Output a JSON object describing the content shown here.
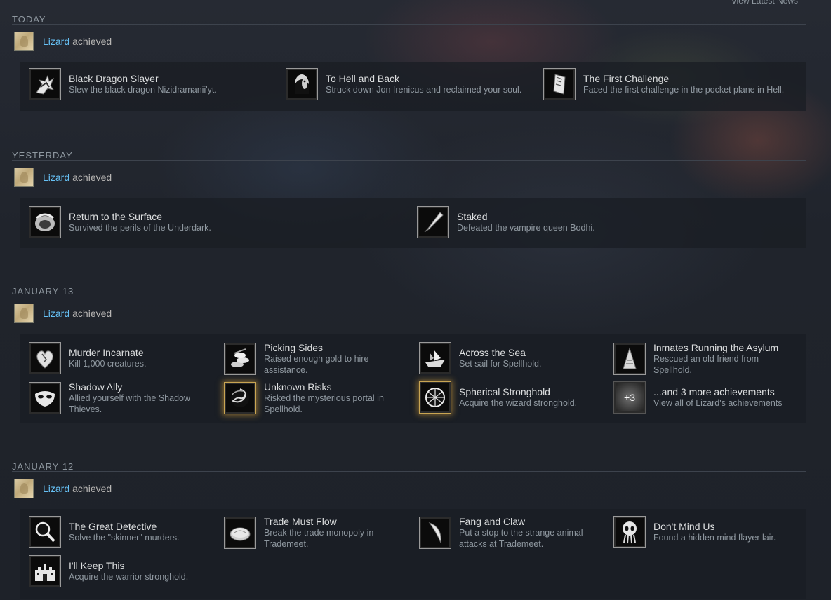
{
  "header": {
    "view_latest_news": "View Latest News"
  },
  "groups": [
    {
      "date": "TODAY",
      "user": "Lizard",
      "verb": "achieved",
      "achievements": [
        {
          "title": "Black Dragon Slayer",
          "desc": "Slew the black dragon Nizidramanii'yt.",
          "icon": "dragon-icon"
        },
        {
          "title": "To Hell and Back",
          "desc": "Struck down Jon Irenicus and reclaimed your soul.",
          "icon": "face-icon"
        },
        {
          "title": "The First Challenge",
          "desc": "Faced the first challenge in the pocket plane in Hell.",
          "icon": "scroll-icon"
        }
      ]
    },
    {
      "date": "YESTERDAY",
      "user": "Lizard",
      "verb": "achieved",
      "achievements": [
        {
          "title": "Return to the Surface",
          "desc": "Survived the perils of the Underdark.",
          "icon": "cave-icon"
        },
        {
          "title": "Staked",
          "desc": "Defeated the vampire queen Bodhi.",
          "icon": "stake-icon"
        }
      ]
    },
    {
      "date": "JANUARY 13",
      "user": "Lizard",
      "verb": "achieved",
      "achievements": [
        {
          "title": "Murder Incarnate",
          "desc": "Kill 1,000 creatures.",
          "icon": "heart-icon"
        },
        {
          "title": "Picking Sides",
          "desc": "Raised enough gold to hire assistance.",
          "icon": "coins-icon"
        },
        {
          "title": "Across the Sea",
          "desc": "Set sail for Spellhold.",
          "icon": "ship-icon"
        },
        {
          "title": "Inmates Running the Asylum",
          "desc": "Rescued an old friend from Spellhold.",
          "icon": "tower-icon"
        },
        {
          "title": "Shadow Ally",
          "desc": "Allied yourself with the Shadow Thieves.",
          "icon": "mask-icon"
        },
        {
          "title": "Unknown Risks",
          "desc": "Risked the mysterious portal in Spellhold.",
          "icon": "portal-icon"
        },
        {
          "title": "Spherical Stronghold",
          "desc": "Acquire the wizard stronghold.",
          "icon": "sphere-icon"
        },
        {
          "title": "...and 3 more achievements",
          "desc": "View all of Lizard's achievements",
          "icon": "more-icon",
          "more_label": "+3"
        }
      ]
    },
    {
      "date": "JANUARY 12",
      "user": "Lizard",
      "verb": "achieved",
      "achievements": [
        {
          "title": "The Great Detective",
          "desc": "Solve the \"skinner\" murders.",
          "icon": "magnifier-icon"
        },
        {
          "title": "Trade Must Flow",
          "desc": "Break the trade monopoly in Trademeet.",
          "icon": "coin-icon"
        },
        {
          "title": "Fang and Claw",
          "desc": "Put a stop to the strange animal attacks at Trademeet.",
          "icon": "claw-icon"
        },
        {
          "title": "Don't Mind Us",
          "desc": "Found a hidden mind flayer lair.",
          "icon": "mindflayer-icon"
        },
        {
          "title": "I'll Keep This",
          "desc": "Acquire the warrior stronghold.",
          "icon": "castle-icon"
        }
      ]
    }
  ]
}
